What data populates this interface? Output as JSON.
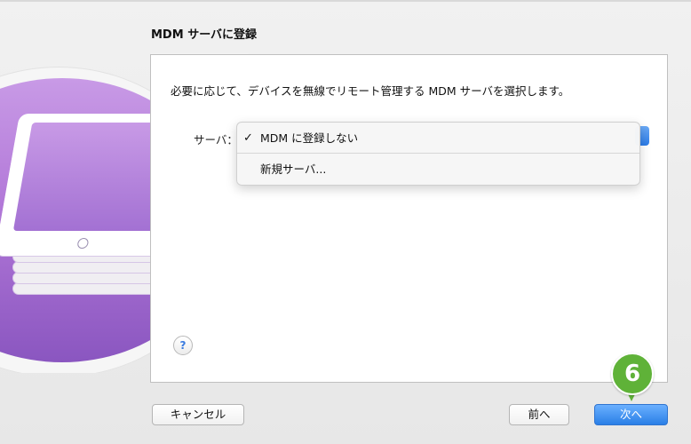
{
  "dialog": {
    "title": "MDM サーバに登録",
    "description": "必要に応じて、デバイスを無線でリモート管理する MDM サーバを選択します。",
    "server_label": "サーバ：",
    "help_glyph": "?"
  },
  "server_menu": {
    "items": [
      {
        "label": "MDM に登録しない",
        "checked": true,
        "check_glyph": "✓"
      },
      {
        "label": "新規サーバ...",
        "checked": false
      }
    ]
  },
  "buttons": {
    "cancel": "キャンセル",
    "back": "前へ",
    "next": "次へ"
  },
  "step_marker": {
    "label": "6",
    "color": "#5fb238"
  },
  "colors": {
    "accent": "#2a7fe6",
    "illustration": "#b278d8"
  }
}
